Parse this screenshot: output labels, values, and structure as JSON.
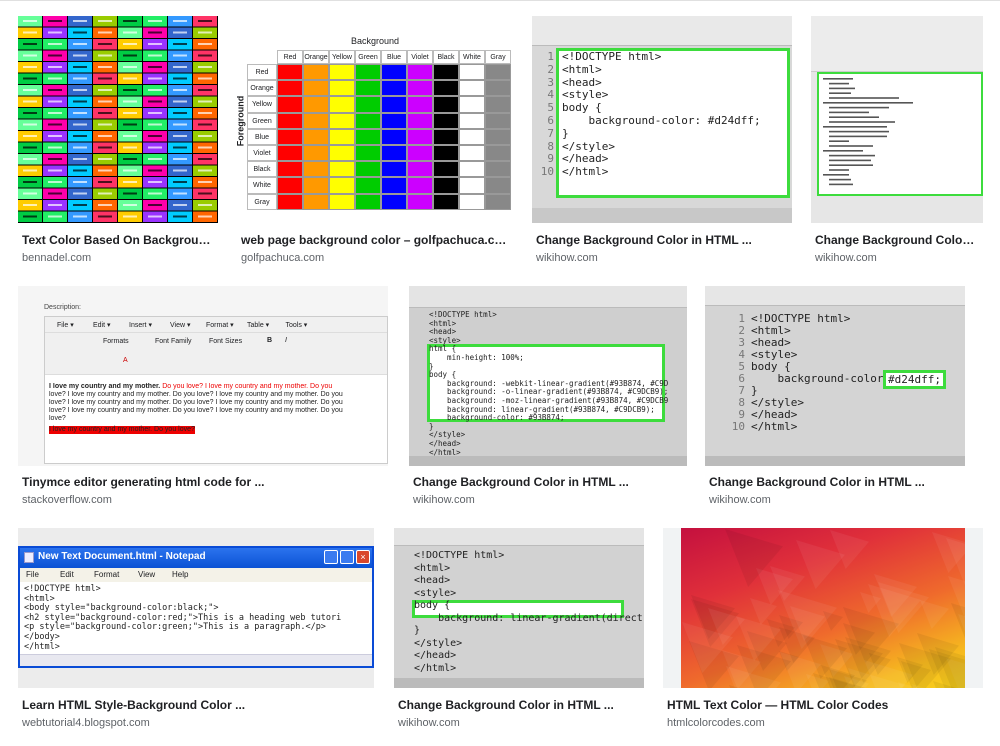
{
  "results": [
    {
      "title": "Text Color Based On Background ...",
      "source": "bennadel.com"
    },
    {
      "title": "web page background color – golfpachuca.com",
      "source": "golfpachuca.com"
    },
    {
      "title": "Change Background Color in HTML ...",
      "source": "wikihow.com"
    },
    {
      "title": "Change Background Color i...",
      "source": "wikihow.com"
    },
    {
      "title": "Tinymce editor generating html code for ...",
      "source": "stackoverflow.com"
    },
    {
      "title": "Change Background Color in HTML ...",
      "source": "wikihow.com"
    },
    {
      "title": "Change Background Color in HTML ...",
      "source": "wikihow.com"
    },
    {
      "title": "Learn HTML Style-Background Color ...",
      "source": "webtutorial4.blogspot.com"
    },
    {
      "title": "Change Background Color in HTML ...",
      "source": "wikihow.com"
    },
    {
      "title": "HTML Text Color — HTML Color Codes",
      "source": "htmlcolorcodes.com"
    }
  ],
  "contrast_chart": {
    "header": "Background",
    "side": "Foreground",
    "colors": [
      "Red",
      "Orange",
      "Yellow",
      "Green",
      "Blue",
      "Violet",
      "Black",
      "White",
      "Gray"
    ],
    "hex": [
      "#ff0000",
      "#ff9900",
      "#ffff00",
      "#00cc00",
      "#0000ff",
      "#cc00ff",
      "#000000",
      "#ffffff",
      "#888888"
    ]
  },
  "code1": {
    "lines": [
      "<!DOCTYPE html>",
      "<html>",
      "<head>",
      "<style>",
      "body {",
      "    background-color: #d24dff;",
      "}",
      "</style>",
      "</head>",
      "</html>"
    ],
    "numbers": [
      "1",
      "2",
      "3",
      "4",
      "5",
      "6",
      "7",
      "8",
      "9",
      "10"
    ]
  },
  "code_gradient": {
    "lines": [
      "<!DOCTYPE html>",
      "<html>",
      "<head>",
      "<style>",
      "html {",
      "    min-height: 100%;",
      "}",
      "body {",
      "    background: -webkit-linear-gradient(#93B874, #C9D",
      "    background: -o-linear-gradient(#93B874, #C9DCB9);",
      "    background: -moz-linear-gradient(#93B874, #C9DCB9",
      "    background: linear-gradient(#93B874, #C9DCB9);",
      "    background-color: #93B874;",
      "}",
      "</style>",
      "</head>",
      "</html>"
    ]
  },
  "code3": {
    "lines": [
      "<!DOCTYPE html>",
      "<html>",
      "<head>",
      "<style>",
      "body {",
      "    background-color: ",
      "}",
      "</style>",
      "</head>",
      "</html>"
    ],
    "highlight": "#d24dff;",
    "numbers": [
      "1",
      "2",
      "3",
      "4",
      "5",
      "6",
      "7",
      "8",
      "9",
      "10"
    ]
  },
  "tinymce": {
    "label": "Description:",
    "menus": [
      "File",
      "Edit",
      "Insert",
      "View",
      "Format",
      "Table",
      "Tools"
    ],
    "formats": "Formats",
    "font_family": "Font Family",
    "font_sizes": "Font Sizes",
    "para_bold": "I love my country and my mother.",
    "para_red": " Do you love? I love my country and my mother. Do you",
    "para_rest": [
      "love?  I love my country and my mother. Do you love?  I love my country and my mother. Do you",
      "love?  I love my country and my mother. Do you love?  I love my country and my mother. Do you",
      "love?  I love my country and my mother. Do you love?  I love my country and my mother. Do you",
      "love?"
    ],
    "para_highlight": "I love my country and my mother. Do you love?"
  },
  "notepad": {
    "title": "New Text Document.html - Notepad",
    "menus": [
      "File",
      "Edit",
      "Format",
      "View",
      "Help"
    ],
    "lines": [
      "<!DOCTYPE html>",
      "<html>",
      "<body style=\"background-color:black;\">",
      "<h2 style=\"background-color:red;\">This is a heading web tutori",
      "<p style=\"background-color:green;\">This is a paragraph.</p>",
      "</body>",
      "</html>"
    ]
  },
  "code4": {
    "lines": [
      "<!DOCTYPE html>",
      "<html>",
      "<head>",
      "<style>",
      "body {",
      "    background: linear-gradient(direct",
      "}",
      "</style>",
      "</head>",
      "</html>"
    ]
  }
}
